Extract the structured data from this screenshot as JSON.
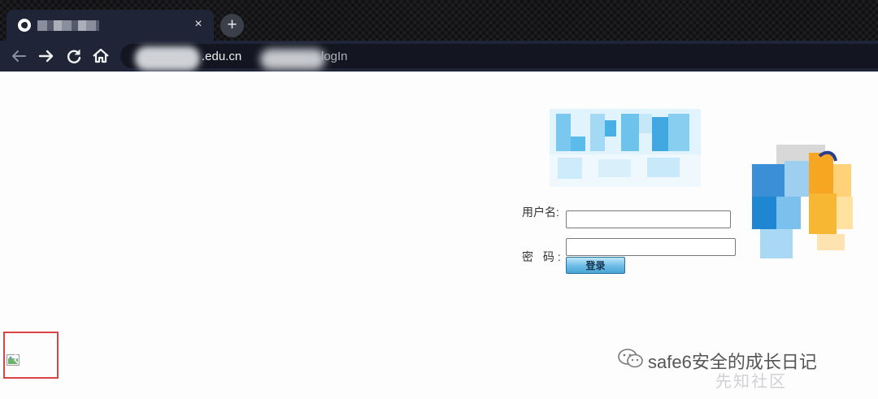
{
  "browser": {
    "tab": {
      "close_glyph": "×"
    },
    "new_tab_glyph": "+",
    "address": {
      "domain_text": ".edu.cn",
      "path_text": "logIn"
    }
  },
  "login_form": {
    "username_label": "用户名:",
    "password_label": "密 码:",
    "username_value": "",
    "password_value": "",
    "submit_label": "登录"
  },
  "watermark": {
    "text": "safe6安全的成长日记",
    "faint_text": "先知社区"
  },
  "colors": {
    "chrome_bg": "#1f2436",
    "highlight_border": "#d94546",
    "button_blue": "#6bbce6"
  },
  "icons": [
    "favicon-icon",
    "close-icon",
    "plus-icon",
    "back-arrow-icon",
    "forward-arrow-icon",
    "reload-icon",
    "home-icon",
    "broken-image-icon",
    "wechat-icon"
  ]
}
